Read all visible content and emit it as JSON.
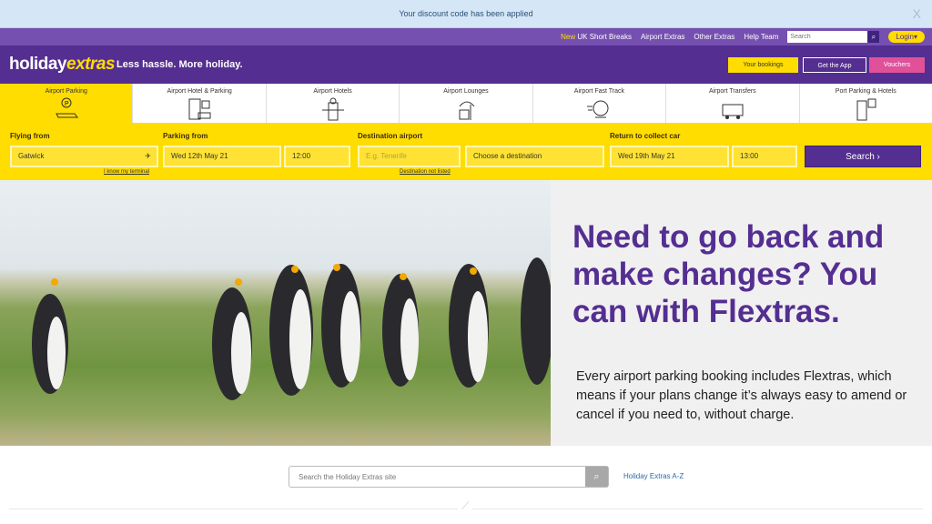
{
  "banner": {
    "message": "Your discount code has been applied",
    "close": "X"
  },
  "topnav": {
    "new_label": "New",
    "items": [
      "UK Short Breaks",
      "Airport Extras",
      "Other Extras",
      "Help Team"
    ],
    "search_placeholder": "Search",
    "login": "Login"
  },
  "header": {
    "logo_a": "holiday",
    "logo_b": "extras",
    "tagline": "Less hassle. More holiday.",
    "buttons": [
      "Your bookings",
      "Get the App",
      "Vouchers"
    ]
  },
  "tabs": [
    "Airport Parking",
    "Airport Hotel & Parking",
    "Airport Hotels",
    "Airport Lounges",
    "Airport Fast Track",
    "Airport Transfers",
    "Port Parking & Hotels"
  ],
  "form": {
    "flying_from_label": "Flying from",
    "flying_from": "Gatwick",
    "know_terminal": "I know my terminal",
    "parking_from_label": "Parking from",
    "parking_date": "Wed 12th May 21",
    "parking_time": "12:00",
    "destination_label": "Destination airport",
    "destination_placeholder": "E.g. Tenerife",
    "destination_select": "Choose a destination",
    "destination_not_listed": "Destination not listed",
    "return_label": "Return to collect car",
    "return_date": "Wed 19th May 21",
    "return_time": "13:00",
    "search": "Search ›"
  },
  "hero": {
    "headline": "Need to go back and make changes? You can with Flextras.",
    "body": "Every airport parking booking includes Flextras, which means if your plans change it’s always easy to amend or cancel if you need to, without charge."
  },
  "footer": {
    "search_placeholder": "Search the Holiday Extras site",
    "az_link": "Holiday Extras A-Z"
  }
}
